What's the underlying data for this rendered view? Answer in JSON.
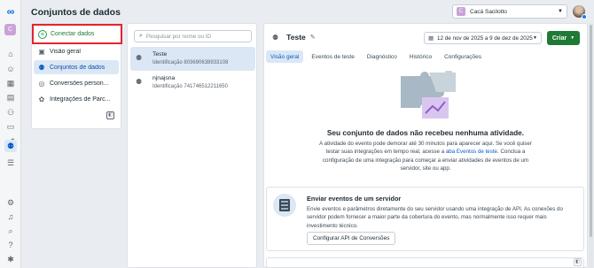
{
  "header": {
    "title": "Conjuntos de dados"
  },
  "account": {
    "initial": "C",
    "name": "Cacá Sacilotto"
  },
  "rail": {
    "logo": "∞",
    "app_initial": "C",
    "icons": [
      "meta-logo-icon",
      "home-icon",
      "smiley-icon",
      "table-icon",
      "catalog-icon",
      "audience-icon",
      "card-icon",
      "megaphone-icon",
      "events-manager-icon",
      "menu-icon",
      "settings-icon",
      "bell-icon",
      "search-icon",
      "help-icon",
      "bug-icon"
    ]
  },
  "nav": {
    "connect": "Conectar dados",
    "items": [
      {
        "label": "Visão geral",
        "icon": "overview-icon"
      },
      {
        "label": "Conjuntos de dados",
        "icon": "datasets-icon"
      },
      {
        "label": "Conversões person...",
        "icon": "custom-conversions-icon"
      },
      {
        "label": "Integrações de Parc...",
        "icon": "partner-integrations-icon"
      }
    ]
  },
  "search": {
    "placeholder": "Pesquisar por nome ou ID"
  },
  "datasets": [
    {
      "name": "Teste",
      "id": "Identificação 803690638933108"
    },
    {
      "name": "njnajsna",
      "id": "Identificação 741746512211650"
    }
  ],
  "main": {
    "dataset_name": "Teste",
    "date_range": "12 de nov de 2025 a 9 de dez de 2025",
    "create": "Criar",
    "tabs": [
      "Visão geral",
      "Eventos de teste",
      "Diagnóstico",
      "Histórico",
      "Configurações"
    ],
    "empty_title": "Seu conjunto de dados não recebeu nenhuma atividade.",
    "empty_body_1": "A atividade do evento pode demorar até 30 minutos para aparecer aqui. Se você quiser testar suas integrações em tempo real, acesse a ",
    "empty_link": "aba Eventos de teste",
    "empty_body_2": ". Conclua a configuração de uma integração para começar a enviar atividades de eventos de um servidor, site ou app.",
    "card_title": "Enviar eventos de um servidor",
    "card_body": "Envie eventos e parâmetros diretamente do seu servidor usando uma integração de API. As conexões do servidor podem fornecer a maior parte da cobertura do evento, mas normalmente isso requer mais investimento técnico.",
    "card_button": "Configurar API de Conversões"
  },
  "colors": {
    "accent": "#0a5bc4",
    "create_button": "#1f7a36",
    "highlight_border": "#e0262f"
  }
}
